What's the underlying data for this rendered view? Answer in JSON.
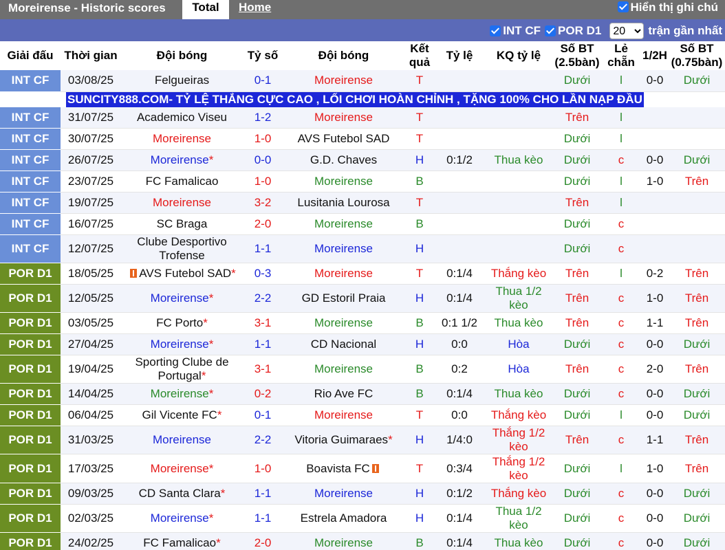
{
  "topbar": {
    "title": "Moreirense - Historic scores",
    "tab_total": "Total",
    "tab_home": "Home",
    "show_notes": "Hiển thị ghi chú"
  },
  "filters": {
    "int_cf": "INT CF",
    "por_d1": "POR D1",
    "count_value": "20",
    "recent_label": "trận gần nhất"
  },
  "headers": {
    "league": "Giải đấu",
    "time": "Thời gian",
    "home": "Đội bóng",
    "score": "Tỷ số",
    "away": "Đội bóng",
    "result": "Kết quả",
    "odds": "Tỷ lệ",
    "odds_result": "KQ tỷ lệ",
    "goals25": "Số BT (2.5bàn)",
    "oddeven": "Lẻ chẵn",
    "half": "1/2H",
    "goals075": "Số BT (0.75bàn)"
  },
  "ad_text": "SUNCITY888.COM- TỶ LỆ THẮNG CỰC CAO , LỐI CHƠI HOÀN CHỈNH , TẶNG 100% CHO LẦN NẠP ĐẦU",
  "colors": {
    "int_cf": "#6a8fd8",
    "por_d1": "#6b8e23",
    "ad": "#1c27d8",
    "topbar": "#6f6f6f",
    "filterbar": "#5b6ab8"
  },
  "matches": [
    {
      "league": "INT CF",
      "cls": "intcf",
      "date": "03/08/25",
      "home": "Felgueiras",
      "hc": "black",
      "hstar": "",
      "hcard": "",
      "score_h": "0",
      "score_a": "1",
      "sc": "blue",
      "away": "Moreirense",
      "ac": "red",
      "astar": "",
      "acard": "",
      "res": "T",
      "rc": "red",
      "odds": "",
      "oddsres": "",
      "orc": "",
      "g25": "Dưới",
      "g25c": "green",
      "oe": "l",
      "oec": "green",
      "half": "0-0",
      "g075": "Dưới",
      "g075c": "green"
    },
    {
      "league": "INT CF",
      "cls": "intcf",
      "date": "31/07/25",
      "home": "Academico Viseu",
      "hc": "black",
      "hstar": "",
      "hcard": "",
      "score_h": "1",
      "score_a": "2",
      "sc": "blue",
      "away": "Moreirense",
      "ac": "red",
      "astar": "",
      "acard": "",
      "res": "T",
      "rc": "red",
      "odds": "",
      "oddsres": "",
      "orc": "",
      "g25": "Trên",
      "g25c": "red",
      "oe": "l",
      "oec": "green",
      "half": "",
      "g075": "",
      "g075c": ""
    },
    {
      "league": "INT CF",
      "cls": "intcf",
      "date": "30/07/25",
      "home": "Moreirense",
      "hc": "red",
      "hstar": "",
      "hcard": "",
      "score_h": "1",
      "score_a": "0",
      "sc": "red",
      "away": "AVS Futebol SAD",
      "ac": "black",
      "astar": "",
      "acard": "",
      "res": "T",
      "rc": "red",
      "odds": "",
      "oddsres": "",
      "orc": "",
      "g25": "Dưới",
      "g25c": "green",
      "oe": "l",
      "oec": "green",
      "half": "",
      "g075": "",
      "g075c": ""
    },
    {
      "league": "INT CF",
      "cls": "intcf",
      "date": "26/07/25",
      "home": "Moreirense",
      "hc": "blue",
      "hstar": "*",
      "hcard": "",
      "score_h": "0",
      "score_a": "0",
      "sc": "blue",
      "away": "G.D. Chaves",
      "ac": "black",
      "astar": "",
      "acard": "",
      "res": "H",
      "rc": "blue",
      "odds": "0:1/2",
      "oddsres": "Thua kèo",
      "orc": "green",
      "g25": "Dưới",
      "g25c": "green",
      "oe": "c",
      "oec": "red",
      "half": "0-0",
      "g075": "Dưới",
      "g075c": "green"
    },
    {
      "league": "INT CF",
      "cls": "intcf",
      "date": "23/07/25",
      "home": "FC Famalicao",
      "hc": "black",
      "hstar": "",
      "hcard": "",
      "score_h": "1",
      "score_a": "0",
      "sc": "red",
      "away": "Moreirense",
      "ac": "green",
      "astar": "",
      "acard": "",
      "res": "B",
      "rc": "green",
      "odds": "",
      "oddsres": "",
      "orc": "",
      "g25": "Dưới",
      "g25c": "green",
      "oe": "l",
      "oec": "green",
      "half": "1-0",
      "g075": "Trên",
      "g075c": "red"
    },
    {
      "league": "INT CF",
      "cls": "intcf",
      "date": "19/07/25",
      "home": "Moreirense",
      "hc": "red",
      "hstar": "",
      "hcard": "",
      "score_h": "3",
      "score_a": "2",
      "sc": "red",
      "away": "Lusitania Lourosa",
      "ac": "black",
      "astar": "",
      "acard": "",
      "res": "T",
      "rc": "red",
      "odds": "",
      "oddsres": "",
      "orc": "",
      "g25": "Trên",
      "g25c": "red",
      "oe": "l",
      "oec": "green",
      "half": "",
      "g075": "",
      "g075c": ""
    },
    {
      "league": "INT CF",
      "cls": "intcf",
      "date": "16/07/25",
      "home": "SC Braga",
      "hc": "black",
      "hstar": "",
      "hcard": "",
      "score_h": "2",
      "score_a": "0",
      "sc": "red",
      "away": "Moreirense",
      "ac": "green",
      "astar": "",
      "acard": "",
      "res": "B",
      "rc": "green",
      "odds": "",
      "oddsres": "",
      "orc": "",
      "g25": "Dưới",
      "g25c": "green",
      "oe": "c",
      "oec": "red",
      "half": "",
      "g075": "",
      "g075c": ""
    },
    {
      "league": "INT CF",
      "cls": "intcf",
      "date": "12/07/25",
      "home": "Clube Desportivo Trofense",
      "hc": "black",
      "hstar": "",
      "hcard": "",
      "score_h": "1",
      "score_a": "1",
      "sc": "blue",
      "away": "Moreirense",
      "ac": "blue",
      "astar": "",
      "acard": "",
      "res": "H",
      "rc": "blue",
      "odds": "",
      "oddsres": "",
      "orc": "",
      "g25": "Dưới",
      "g25c": "green",
      "oe": "c",
      "oec": "red",
      "half": "",
      "g075": "",
      "g075c": ""
    },
    {
      "league": "POR D1",
      "cls": "pord1",
      "date": "18/05/25",
      "home": "AVS Futebol SAD",
      "hc": "black",
      "hstar": "*",
      "hcard": "1",
      "score_h": "0",
      "score_a": "3",
      "sc": "blue",
      "away": "Moreirense",
      "ac": "red",
      "astar": "",
      "acard": "",
      "res": "T",
      "rc": "red",
      "odds": "0:1/4",
      "oddsres": "Thắng kèo",
      "orc": "red",
      "g25": "Trên",
      "g25c": "red",
      "oe": "l",
      "oec": "green",
      "half": "0-2",
      "g075": "Trên",
      "g075c": "red"
    },
    {
      "league": "POR D1",
      "cls": "pord1",
      "date": "12/05/25",
      "home": "Moreirense",
      "hc": "blue",
      "hstar": "*",
      "hcard": "",
      "score_h": "2",
      "score_a": "2",
      "sc": "blue",
      "away": "GD Estoril Praia",
      "ac": "black",
      "astar": "",
      "acard": "",
      "res": "H",
      "rc": "blue",
      "odds": "0:1/4",
      "oddsres": "Thua 1/2 kèo",
      "orc": "green",
      "g25": "Trên",
      "g25c": "red",
      "oe": "c",
      "oec": "red",
      "half": "1-0",
      "g075": "Trên",
      "g075c": "red"
    },
    {
      "league": "POR D1",
      "cls": "pord1",
      "date": "03/05/25",
      "home": "FC Porto",
      "hc": "black",
      "hstar": "*",
      "hcard": "",
      "score_h": "3",
      "score_a": "1",
      "sc": "red",
      "away": "Moreirense",
      "ac": "green",
      "astar": "",
      "acard": "",
      "res": "B",
      "rc": "green",
      "odds": "0:1 1/2",
      "oddsres": "Thua kèo",
      "orc": "green",
      "g25": "Trên",
      "g25c": "red",
      "oe": "c",
      "oec": "red",
      "half": "1-1",
      "g075": "Trên",
      "g075c": "red"
    },
    {
      "league": "POR D1",
      "cls": "pord1",
      "date": "27/04/25",
      "home": "Moreirense",
      "hc": "blue",
      "hstar": "*",
      "hcard": "",
      "score_h": "1",
      "score_a": "1",
      "sc": "blue",
      "away": "CD Nacional",
      "ac": "black",
      "astar": "",
      "acard": "",
      "res": "H",
      "rc": "blue",
      "odds": "0:0",
      "oddsres": "Hòa",
      "orc": "blue",
      "g25": "Dưới",
      "g25c": "green",
      "oe": "c",
      "oec": "red",
      "half": "0-0",
      "g075": "Dưới",
      "g075c": "green"
    },
    {
      "league": "POR D1",
      "cls": "pord1",
      "date": "19/04/25",
      "home": "Sporting Clube de Portugal",
      "hc": "black",
      "hstar": "*",
      "hcard": "",
      "score_h": "3",
      "score_a": "1",
      "sc": "red",
      "away": "Moreirense",
      "ac": "green",
      "astar": "",
      "acard": "",
      "res": "B",
      "rc": "green",
      "odds": "0:2",
      "oddsres": "Hòa",
      "orc": "blue",
      "g25": "Trên",
      "g25c": "red",
      "oe": "c",
      "oec": "red",
      "half": "2-0",
      "g075": "Trên",
      "g075c": "red"
    },
    {
      "league": "POR D1",
      "cls": "pord1",
      "date": "14/04/25",
      "home": "Moreirense",
      "hc": "green",
      "hstar": "*",
      "hcard": "",
      "score_h": "0",
      "score_a": "2",
      "sc": "red",
      "away": "Rio Ave FC",
      "ac": "black",
      "astar": "",
      "acard": "",
      "res": "B",
      "rc": "green",
      "odds": "0:1/4",
      "oddsres": "Thua kèo",
      "orc": "green",
      "g25": "Dưới",
      "g25c": "green",
      "oe": "c",
      "oec": "red",
      "half": "0-0",
      "g075": "Dưới",
      "g075c": "green"
    },
    {
      "league": "POR D1",
      "cls": "pord1",
      "date": "06/04/25",
      "home": "Gil Vicente FC",
      "hc": "black",
      "hstar": "*",
      "hcard": "",
      "score_h": "0",
      "score_a": "1",
      "sc": "blue",
      "away": "Moreirense",
      "ac": "red",
      "astar": "",
      "acard": "",
      "res": "T",
      "rc": "red",
      "odds": "0:0",
      "oddsres": "Thắng kèo",
      "orc": "red",
      "g25": "Dưới",
      "g25c": "green",
      "oe": "l",
      "oec": "green",
      "half": "0-0",
      "g075": "Dưới",
      "g075c": "green"
    },
    {
      "league": "POR D1",
      "cls": "pord1",
      "date": "31/03/25",
      "home": "Moreirense",
      "hc": "blue",
      "hstar": "",
      "hcard": "",
      "score_h": "2",
      "score_a": "2",
      "sc": "blue",
      "away": "Vitoria Guimaraes",
      "ac": "black",
      "astar": "*",
      "acard": "",
      "res": "H",
      "rc": "blue",
      "odds": "1/4:0",
      "oddsres": "Thắng 1/2 kèo",
      "orc": "red",
      "g25": "Trên",
      "g25c": "red",
      "oe": "c",
      "oec": "red",
      "half": "1-1",
      "g075": "Trên",
      "g075c": "red"
    },
    {
      "league": "POR D1",
      "cls": "pord1",
      "date": "17/03/25",
      "home": "Moreirense",
      "hc": "red",
      "hstar": "*",
      "hcard": "",
      "score_h": "1",
      "score_a": "0",
      "sc": "red",
      "away": "Boavista FC",
      "ac": "black",
      "astar": "",
      "acard": "1",
      "res": "T",
      "rc": "red",
      "odds": "0:3/4",
      "oddsres": "Thắng 1/2 kèo",
      "orc": "red",
      "g25": "Dưới",
      "g25c": "green",
      "oe": "l",
      "oec": "green",
      "half": "1-0",
      "g075": "Trên",
      "g075c": "red"
    },
    {
      "league": "POR D1",
      "cls": "pord1",
      "date": "09/03/25",
      "home": "CD Santa Clara",
      "hc": "black",
      "hstar": "*",
      "hcard": "",
      "score_h": "1",
      "score_a": "1",
      "sc": "blue",
      "away": "Moreirense",
      "ac": "blue",
      "astar": "",
      "acard": "",
      "res": "H",
      "rc": "blue",
      "odds": "0:1/2",
      "oddsres": "Thắng kèo",
      "orc": "red",
      "g25": "Dưới",
      "g25c": "green",
      "oe": "c",
      "oec": "red",
      "half": "0-0",
      "g075": "Dưới",
      "g075c": "green"
    },
    {
      "league": "POR D1",
      "cls": "pord1",
      "date": "02/03/25",
      "home": "Moreirense",
      "hc": "blue",
      "hstar": "*",
      "hcard": "",
      "score_h": "1",
      "score_a": "1",
      "sc": "blue",
      "away": "Estrela Amadora",
      "ac": "black",
      "astar": "",
      "acard": "",
      "res": "H",
      "rc": "blue",
      "odds": "0:1/4",
      "oddsres": "Thua 1/2 kèo",
      "orc": "green",
      "g25": "Dưới",
      "g25c": "green",
      "oe": "c",
      "oec": "red",
      "half": "0-0",
      "g075": "Dưới",
      "g075c": "green"
    },
    {
      "league": "POR D1",
      "cls": "pord1",
      "date": "24/02/25",
      "home": "FC Famalicao",
      "hc": "black",
      "hstar": "*",
      "hcard": "",
      "score_h": "2",
      "score_a": "0",
      "sc": "red",
      "away": "Moreirense",
      "ac": "green",
      "astar": "",
      "acard": "",
      "res": "B",
      "rc": "green",
      "odds": "0:1/4",
      "oddsres": "Thua kèo",
      "orc": "green",
      "g25": "Dưới",
      "g25c": "green",
      "oe": "c",
      "oec": "red",
      "half": "0-0",
      "g075": "Dưới",
      "g075c": "green"
    }
  ]
}
